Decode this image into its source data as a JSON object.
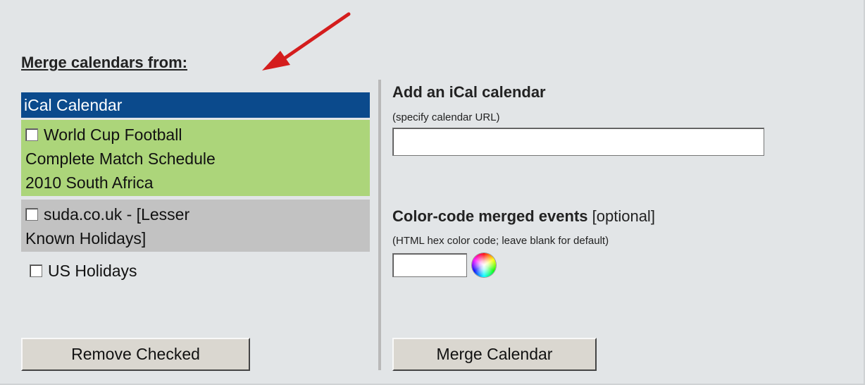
{
  "merge_header": "Merge calendars from:",
  "calendar_list": {
    "header": "iCal Calendar",
    "items": [
      {
        "lines": [
          "World Cup Football",
          "Complete Match Schedule",
          "2010 South Africa"
        ],
        "checked": false,
        "bg": "#acd57a"
      },
      {
        "lines": [
          "suda.co.uk - [Lesser",
          "Known Holidays]"
        ],
        "checked": false,
        "bg": "#c2c2c2"
      },
      {
        "lines": [
          "US Holidays"
        ],
        "checked": false
      }
    ]
  },
  "remove_button": "Remove Checked",
  "add_ical": {
    "title": "Add an iCal calendar",
    "hint": "(specify calendar URL)",
    "url_value": ""
  },
  "color_code": {
    "title": "Color-code merged events",
    "optional": "[optional]",
    "hint": "(HTML hex color code; leave blank for default)",
    "value": ""
  },
  "merge_button": "Merge Calendar",
  "colors": {
    "header_bg": "#0b4a8c",
    "world_cup_bg": "#acd57a",
    "suda_bg": "#c2c2c2",
    "panel_bg": "#e2e5e7",
    "arrow": "#d41d1d"
  },
  "icons": [
    "red-arrow-icon",
    "color-wheel-icon",
    "checkbox-icon"
  ]
}
